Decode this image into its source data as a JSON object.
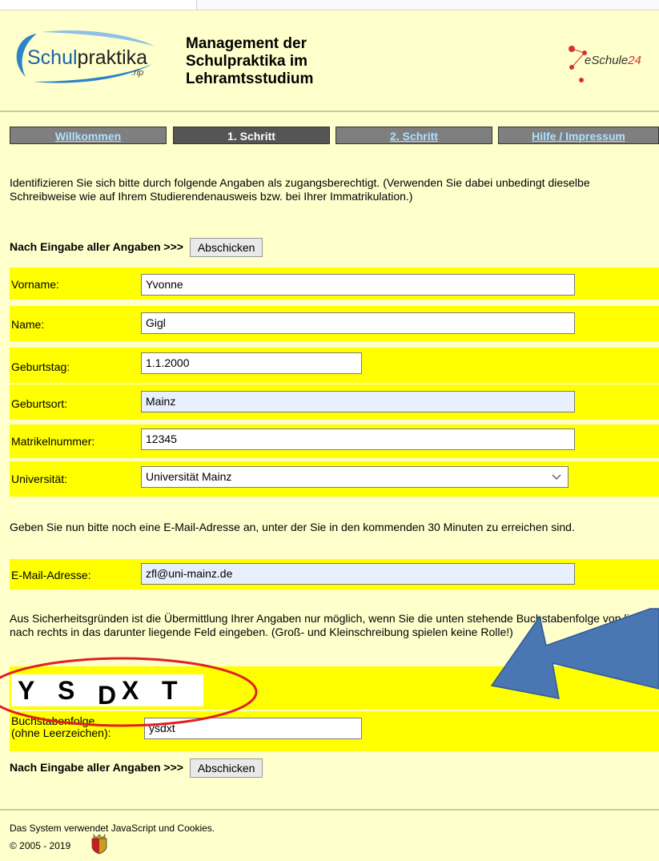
{
  "header": {
    "logo_text_a": "Schul",
    "logo_text_b": "praktika",
    "logo_suffix": ".rlp",
    "title_lines": [
      "Management der",
      "Schulpraktika im",
      "Lehramtsstudium"
    ],
    "partner_logo_a": "eSchule",
    "partner_logo_b": "24"
  },
  "nav": [
    {
      "label": "Willkommen",
      "active": false
    },
    {
      "label": "1. Schritt",
      "active": true
    },
    {
      "label": "2. Schritt",
      "active": false
    },
    {
      "label": "Hilfe / Impressum",
      "active": false
    }
  ],
  "intro": "Identifizieren Sie sich bitte durch folgende Angaben als zugangsberechtigt. (Verwenden Sie dabei unbedingt dieselbe Schreibweise wie auf Ihrem Studierendenausweis bzw. bei Ihrer Immatrikulation.)",
  "submit": {
    "prompt": "Nach Eingabe aller Angaben >>>",
    "button": "Abschicken"
  },
  "form": {
    "vorname": {
      "label": "Vorname:",
      "value": "Yvonne"
    },
    "name": {
      "label": "Name:",
      "value": "Gigl"
    },
    "geburtstag": {
      "label": "Geburtstag:",
      "value": "1.1.2000"
    },
    "geburtsort": {
      "label": "Geburtsort:",
      "value": "Mainz"
    },
    "matrikel": {
      "label": "Matrikelnummer:",
      "value": "12345"
    },
    "universitaet": {
      "label": "Universität:",
      "value": "Universität Mainz"
    }
  },
  "email_intro": "Geben Sie nun bitte noch eine E-Mail-Adresse an, unter der Sie in den kommenden 30 Minuten zu erreichen sind.",
  "email": {
    "label": "E-Mail-Adresse:",
    "value": "zfl@uni-mainz.de"
  },
  "security_text": "Aus Sicherheitsgründen ist die Übermittlung Ihrer Angaben nur möglich, wenn Sie die unten stehende Buchstabenfolge von links nach rechts in das darunter liegende Feld eingeben. (Groß- und Kleinschreibung spielen keine Rolle!)",
  "captcha": {
    "letters": [
      "Y",
      "S",
      "D",
      "X",
      "T"
    ]
  },
  "captcha_input": {
    "label_line1": "Buchstabenfolge",
    "label_line2": "(ohne Leerzeichen):",
    "value": "ysdxt"
  },
  "footer": {
    "line1": "Das System verwendet JavaScript und Cookies.",
    "line2": "© 2005 - 2019"
  },
  "colors": {
    "page_bg": "#ffffcc",
    "row_bg": "#ffff00",
    "nav_bg": "#7f7f7f",
    "nav_active": "#555555",
    "arrow": "#4a76b4",
    "ellipse": "#e02020"
  }
}
